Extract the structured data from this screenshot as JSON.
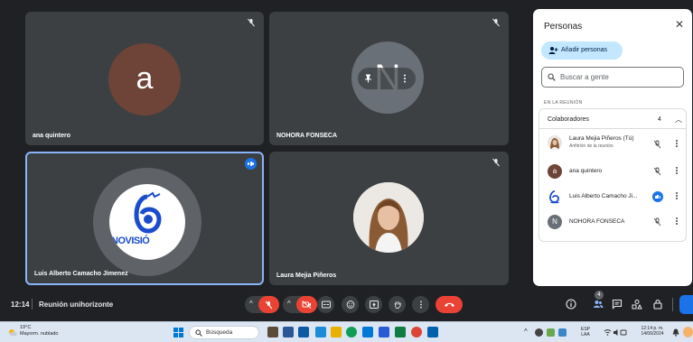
{
  "meeting": {
    "time": "12:14",
    "title": "Reunión unihorizonte"
  },
  "tiles": [
    {
      "name": "ana quintero",
      "avatar_letter": "a",
      "avatar_color": "#6d4437"
    },
    {
      "name": "NOHORA FONSECA",
      "avatar_letter": "N",
      "avatar_color": "#6a7077"
    },
    {
      "name": "Luis Alberto Camacho Jimenez",
      "logo_text": "NOVISIÓ",
      "speaking": true
    },
    {
      "name": "Laura Mejia Piñeros"
    }
  ],
  "panel": {
    "title": "Personas",
    "add_people_label": "Añadir personas",
    "search_placeholder": "Buscar a gente",
    "section_label": "EN LA REUNIÓN",
    "group_label": "Colaboradores",
    "group_count": "4",
    "participants": [
      {
        "name": "Laura Mejia Piñeros (Tú)",
        "subtitle": "Anfitrión de la reunión",
        "avatar": "photo",
        "state": "muted"
      },
      {
        "name": "ana quintero",
        "avatar_letter": "a",
        "avatar_color": "#6d4437",
        "state": "muted"
      },
      {
        "name": "Luis Alberto Camacho Ji...",
        "avatar": "logo",
        "state": "speaking"
      },
      {
        "name": "NOHORA FONSECA",
        "avatar_letter": "N",
        "avatar_color": "#6a7077",
        "state": "muted"
      }
    ]
  },
  "controls": {
    "participants_badge": "4",
    "icons": [
      "mic-off-icon",
      "camera-off-icon",
      "captions-icon",
      "emoji-icon",
      "present-icon",
      "raise-hand-icon",
      "more-icon",
      "end-call-icon"
    ],
    "right_icons": [
      "info-icon",
      "people-icon",
      "chat-icon",
      "activities-icon",
      "host-controls-icon"
    ]
  },
  "taskbar": {
    "weather_temp": "19°C",
    "weather_desc": "Mayorm. nublado",
    "search_label": "Búsqueda",
    "lang": "ESP",
    "lang_sub": "LAA",
    "clock_time": "12:14 p. m.",
    "clock_date": "14/06/2024"
  },
  "colors": {
    "background": "#202124",
    "tile": "#3c4043",
    "accent_blue": "#1a73e8",
    "end_call_red": "#ea4335",
    "active_border": "#8ab4f8"
  }
}
